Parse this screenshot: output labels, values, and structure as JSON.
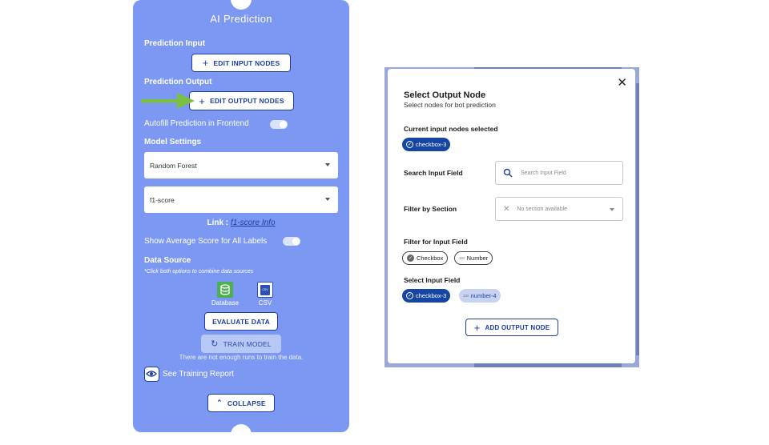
{
  "left_panel": {
    "title": "AI Prediction",
    "prediction_input_label": "Prediction Input",
    "edit_input_nodes_label": "EDIT INPUT NODES",
    "prediction_output_label": "Prediction Output",
    "edit_output_nodes_label": "EDIT OUTPUT NODES",
    "autofill_label": "Autofill Prediction in Frontend",
    "model_settings_label": "Model Settings",
    "model_select_value": "Random Forest",
    "metric_select_value": "f1-score",
    "link_prefix": "Link :",
    "link_text": "f1-score Info",
    "show_average_label": "Show Average Score for All Labels",
    "data_source_label": "Data Source",
    "data_source_note": "*Click both options to combine data sources",
    "database_label": "Database",
    "csv_label": "CSV",
    "csv_icon_text": "CSV",
    "evaluate_label": "EVALUATE DATA",
    "train_label": "TRAIN MODEL",
    "train_note": "There are not enough runs to train the data.",
    "training_report_label": "See Training Report",
    "collapse_label": "COLLAPSE"
  },
  "modal": {
    "title": "Select Output Node",
    "subtitle": "Select nodes for bot prediction",
    "current_label": "Current input nodes selected",
    "current_chips": [
      "checkbox-3"
    ],
    "search_label": "Search Input Field",
    "search_placeholder": "Search Input Field",
    "filter_section_label": "Filter by Section",
    "filter_section_value": "No section available",
    "filter_input_label": "Filter for Input Field",
    "filter_chips": [
      "Checkbox",
      "Number"
    ],
    "select_input_label": "Select Input Field",
    "select_chips": [
      "checkbox-3",
      "number-4"
    ],
    "number_tag": "123",
    "add_output_label": "ADD OUTPUT NODE",
    "background_train_label": "TRAIN MODEL"
  },
  "colors": {
    "panel": "#7c98f3",
    "primary": "#1d3fa3",
    "chip_dark": "#1746a2",
    "arrow": "#7bc043",
    "database_icon": "#4caf50",
    "csv_icon": "#2f4fb8"
  }
}
